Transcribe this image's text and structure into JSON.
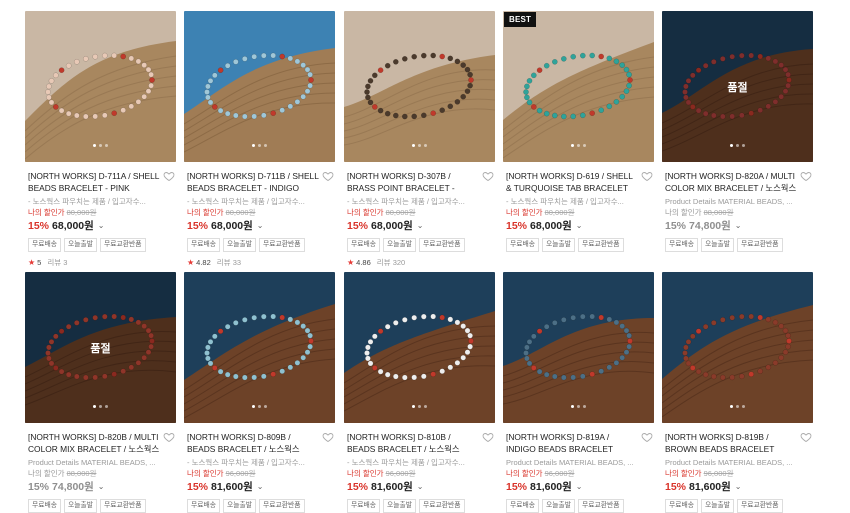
{
  "products": [
    {
      "title": "[NORTH WORKS] D-711A / SHELL BEADS BRACELET - PINK",
      "desc": "- 노스웍스 파우치는 제품 / 입고자수...",
      "my_price_label": "나의 할인가",
      "orig_price": "80,000원",
      "discount": "15%",
      "price": "68,000원",
      "tags": [
        "무료배송",
        "오늘출발",
        "무료교환반품"
      ],
      "rating": "5",
      "review_label": "리뷰",
      "review_count": "3",
      "badge": "",
      "sold_out": "",
      "bg": "wood",
      "bead": "#e8c9b6"
    },
    {
      "title": "[NORTH WORKS] D-711B / SHELL BEADS BRACELET - INDIGO",
      "desc": "- 노스웍스 파우치는 제품 / 입고자수...",
      "my_price_label": "나의 할인가",
      "orig_price": "80,000원",
      "discount": "15%",
      "price": "68,000원",
      "tags": [
        "무료배송",
        "오늘출발",
        "무료교환반품"
      ],
      "rating": "4.82",
      "review_label": "리뷰",
      "review_count": "33",
      "badge": "",
      "sold_out": "",
      "bg": "blue",
      "bead": "#9fc7d8"
    },
    {
      "title": "[NORTH WORKS] D-307B / BRASS POINT BRACELET - SMILE / ...",
      "desc": "- 노스웍스 파우치는 제품 / 입고자수...",
      "my_price_label": "나의 할인가",
      "orig_price": "80,000원",
      "discount": "15%",
      "price": "68,000원",
      "tags": [
        "무료배송",
        "오늘출발",
        "무료교환반품"
      ],
      "rating": "4.86",
      "review_label": "리뷰",
      "review_count": "320",
      "badge": "",
      "sold_out": "",
      "bg": "wood",
      "bead": "#4b3a2c"
    },
    {
      "title": "[NORTH WORKS] D-619 / SHELL & TURQUOISE TAB BRACELET",
      "desc": "- 노스웍스 파우치는 제품 / 입고자수...",
      "my_price_label": "나의 할인가",
      "orig_price": "80,000원",
      "discount": "15%",
      "price": "68,000원",
      "tags": [
        "무료배송",
        "오늘출발",
        "무료교환반품"
      ],
      "rating": "",
      "review_label": "",
      "review_count": "",
      "badge": "BEST",
      "sold_out": "",
      "bg": "wood",
      "bead": "#2fa39a"
    },
    {
      "title": "[NORTH WORKS] D-820A / MULTI COLOR MIX BRACELET / 노스웍스",
      "desc": "Product Details MATERIAL BEADS, ...",
      "my_price_label": "나의 할인가",
      "orig_price": "88,000원",
      "discount": "15%",
      "price": "74,800원",
      "tags": [
        "무료배송",
        "오늘출발",
        "무료교환반품"
      ],
      "rating": "",
      "review_label": "",
      "review_count": "",
      "badge": "",
      "sold_out": "품절",
      "bg": "navy",
      "bead": "#b0413e"
    },
    {
      "title": "[NORTH WORKS] D-820B / MULTI COLOR MIX BRACELET / 노스웍스",
      "desc": "Product Details MATERIAL BEADS, ...",
      "my_price_label": "나의 할인가",
      "orig_price": "88,000원",
      "discount": "15%",
      "price": "74,800원",
      "tags": [
        "무료배송",
        "오늘출발",
        "무료교환반품"
      ],
      "rating": "",
      "review_label": "",
      "review_count": "",
      "badge": "",
      "sold_out": "품절",
      "bg": "navy",
      "bead": "#c74a3a"
    },
    {
      "title": "[NORTH WORKS] D-809B / BEADS BRACELET / 노스웍스",
      "desc": "- 노스웍스 파우치는 제품 / 입고자수...",
      "my_price_label": "나의 할인가",
      "orig_price": "96,000원",
      "discount": "15%",
      "price": "81,600원",
      "tags": [
        "무료배송",
        "오늘출발",
        "무료교환반품"
      ],
      "rating": "",
      "review_label": "",
      "review_count": "",
      "badge": "",
      "sold_out": "",
      "bg": "navy",
      "bead": "#8fc1d0"
    },
    {
      "title": "[NORTH WORKS] D-810B / BEADS BRACELET / 노스웍스",
      "desc": "- 노스웍스 파우치는 제품 / 입고자수...",
      "my_price_label": "나의 할인가",
      "orig_price": "96,000원",
      "discount": "15%",
      "price": "81,600원",
      "tags": [
        "무료배송",
        "오늘출발",
        "무료교환반품"
      ],
      "rating": "",
      "review_label": "",
      "review_count": "",
      "badge": "",
      "sold_out": "",
      "bg": "navy",
      "bead": "#eeeeee"
    },
    {
      "title": "[NORTH WORKS] D-819A / INDIGO BEADS BRACELET",
      "desc": "Product Details MATERIAL BEADS, ...",
      "my_price_label": "나의 할인가",
      "orig_price": "96,000원",
      "discount": "15%",
      "price": "81,600원",
      "tags": [
        "무료배송",
        "오늘출발",
        "무료교환반품"
      ],
      "rating": "",
      "review_label": "",
      "review_count": "",
      "badge": "",
      "sold_out": "",
      "bg": "navy",
      "bead": "#4c6f86"
    },
    {
      "title": "[NORTH WORKS] D-819B / BROWN BEADS BRACELET",
      "desc": "Product Details MATERIAL BEADS, ...",
      "my_price_label": "나의 할인가",
      "orig_price": "96,000원",
      "discount": "15%",
      "price": "81,600원",
      "tags": [
        "무료배송",
        "오늘출발",
        "무료교환반품"
      ],
      "rating": "",
      "review_label": "",
      "review_count": "",
      "badge": "",
      "sold_out": "",
      "bg": "navy",
      "bead": "#8a3b2a"
    }
  ],
  "colors": {
    "sale_red": "#d9342b",
    "star_red": "#e53935",
    "muted_gray": "#9a9a9a"
  }
}
